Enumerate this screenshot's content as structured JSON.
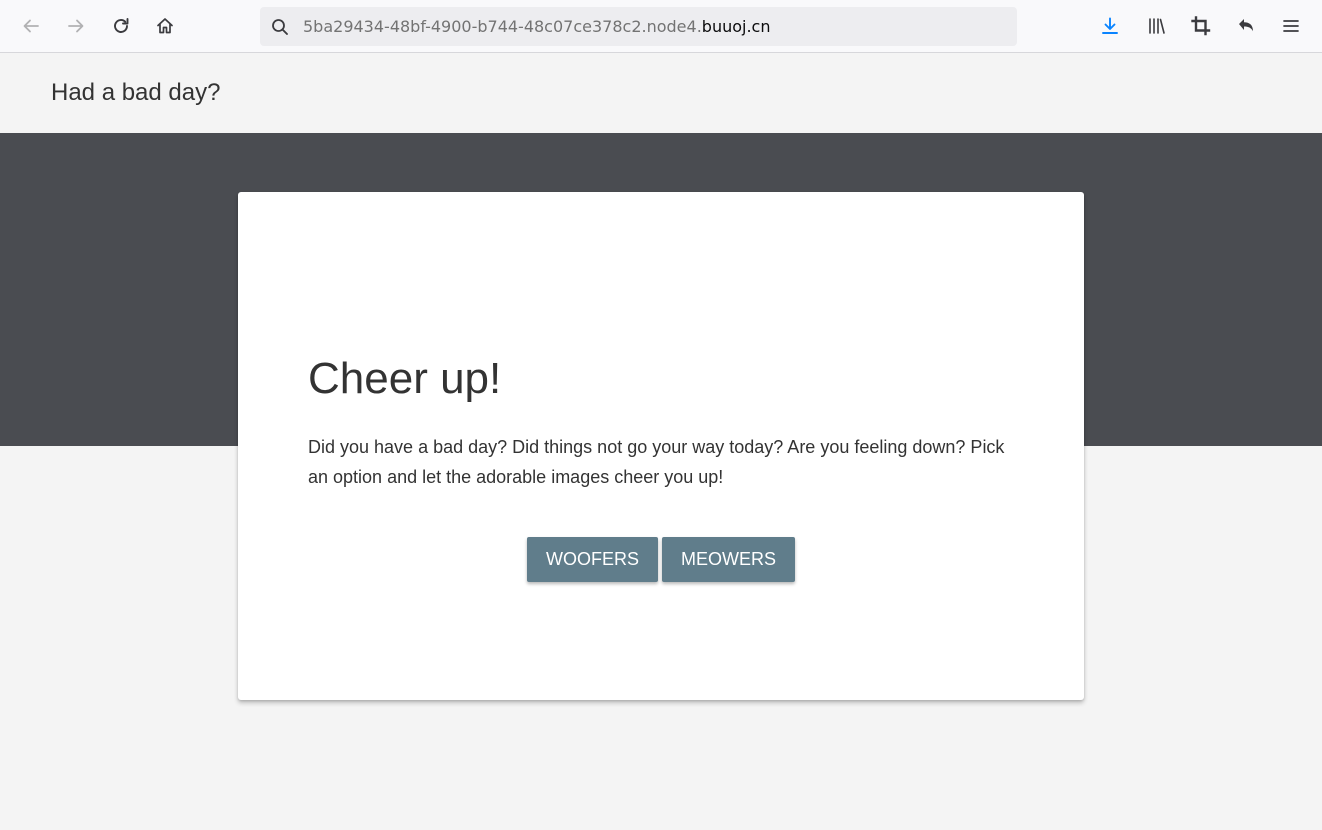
{
  "browser": {
    "url_prefix": "5ba29434-48bf-4900-b744-48c07ce378c2.node4.",
    "url_domain": "buuoj.cn",
    "accent_color": "#0a84ff"
  },
  "site": {
    "title": "Had a bad day?"
  },
  "card": {
    "heading": "Cheer up!",
    "body": "Did you have a bad day? Did things not go your way today? Are you feeling down? Pick an option and let the adorable images cheer you up!",
    "buttons": [
      {
        "label": "WOOFERS"
      },
      {
        "label": "MEOWERS"
      }
    ]
  },
  "colors": {
    "hero_bg": "#4a4c51",
    "button_bg": "#607d8b",
    "page_bg": "#f4f4f4"
  }
}
